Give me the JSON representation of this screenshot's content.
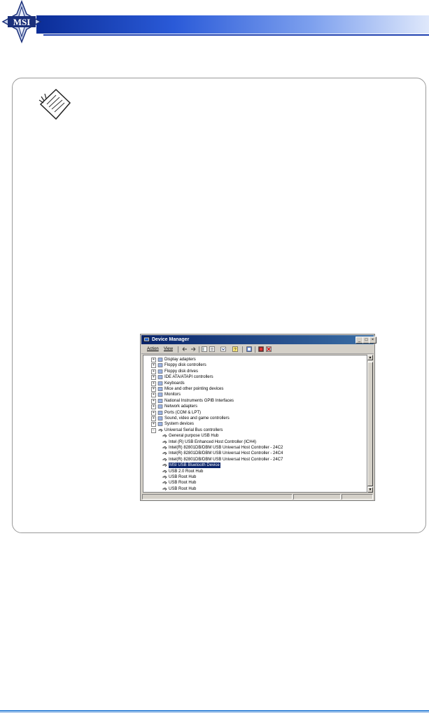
{
  "header": {
    "brand": "MSI",
    "bar_color": "#1c3fb0"
  },
  "note": {
    "icon": "note-paper-icon"
  },
  "window": {
    "title": "Device Manager",
    "controls": [
      "_",
      "□",
      "×"
    ],
    "menu": [
      "Action",
      "View"
    ],
    "toolbar_icons": [
      "back-arrow-icon",
      "forward-arrow-icon",
      "show-tree-icon",
      "properties-icon",
      "refresh-icon",
      "help-icon",
      "scan-hardware-icon",
      "uninstall-icon",
      "disable-icon"
    ],
    "tree": [
      {
        "label": "Display adapters",
        "level": 0,
        "expander": "+",
        "icon": "display-adapter-icon"
      },
      {
        "label": "Floppy disk controllers",
        "level": 0,
        "expander": "+",
        "icon": "floppy-controller-icon"
      },
      {
        "label": "Floppy disk drives",
        "level": 0,
        "expander": "+",
        "icon": "floppy-drive-icon"
      },
      {
        "label": "IDE ATA/ATAPI controllers",
        "level": 0,
        "expander": "+",
        "icon": "ide-controller-icon"
      },
      {
        "label": "Keyboards",
        "level": 0,
        "expander": "+",
        "icon": "keyboard-icon"
      },
      {
        "label": "Mice and other pointing devices",
        "level": 0,
        "expander": "+",
        "icon": "mouse-icon"
      },
      {
        "label": "Monitors",
        "level": 0,
        "expander": "+",
        "icon": "monitor-icon"
      },
      {
        "label": "National Instruments GPIB Interfaces",
        "level": 0,
        "expander": "+",
        "icon": "gpib-icon"
      },
      {
        "label": "Network adapters",
        "level": 0,
        "expander": "+",
        "icon": "network-adapter-icon"
      },
      {
        "label": "Ports (COM & LPT)",
        "level": 0,
        "expander": "+",
        "icon": "port-icon"
      },
      {
        "label": "Sound, video and game controllers",
        "level": 0,
        "expander": "+",
        "icon": "sound-icon"
      },
      {
        "label": "System devices",
        "level": 0,
        "expander": "+",
        "icon": "system-device-icon"
      },
      {
        "label": "Universal Serial Bus controllers",
        "level": 0,
        "expander": "−",
        "icon": "usb-icon"
      },
      {
        "label": "General purpose USB Hub",
        "level": 1,
        "icon": "usb-icon"
      },
      {
        "label": "Intel (R) USB Enhanced Host Controller (ICH4)",
        "level": 1,
        "icon": "usb-icon"
      },
      {
        "label": "Intel(R) 82801DB/DBM USB Universal Host Controller - 24C2",
        "level": 1,
        "icon": "usb-icon"
      },
      {
        "label": "Intel(R) 82801DB/DBM USB Universal Host Controller - 24C4",
        "level": 1,
        "icon": "usb-icon"
      },
      {
        "label": "Intel(R) 82801DB/DBM USB Universal Host Controller - 24C7",
        "level": 1,
        "icon": "usb-icon"
      },
      {
        "label": "MSI USB Bluetooth Device",
        "level": 1,
        "icon": "usb-icon",
        "selected": true
      },
      {
        "label": "USB 2.0 Root Hub",
        "level": 1,
        "icon": "usb-icon"
      },
      {
        "label": "USB Root Hub",
        "level": 1,
        "icon": "usb-icon"
      },
      {
        "label": "USB Root Hub",
        "level": 1,
        "icon": "usb-icon"
      },
      {
        "label": "USB Root Hub",
        "level": 1,
        "icon": "usb-icon"
      }
    ]
  },
  "footer": {
    "line_color": "#2e7fd6"
  }
}
